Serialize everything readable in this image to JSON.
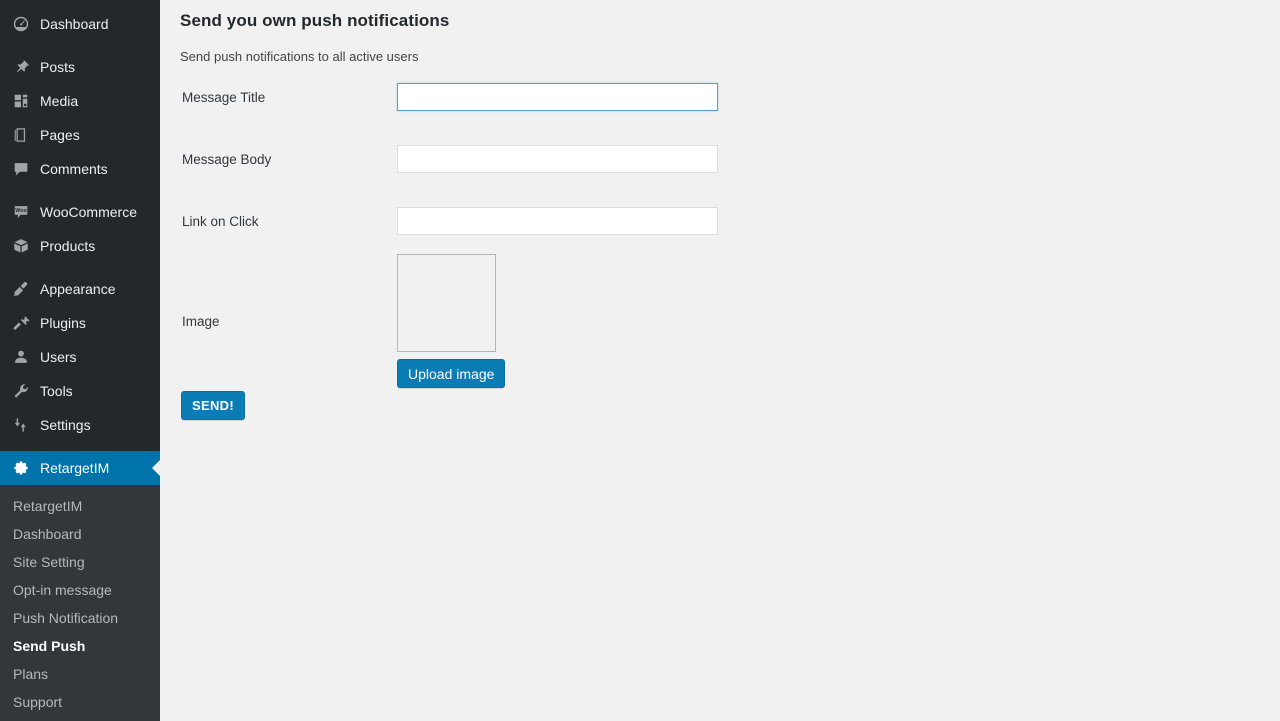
{
  "colors": {
    "sidebar_bg": "#23282d",
    "submenu_bg": "#32373c",
    "accent_blue": "#0073aa",
    "button_blue": "#0c7cb5",
    "content_bg": "#f1f1f1",
    "focus_border": "#5b9dd9"
  },
  "sidebar": {
    "groups": [
      {
        "items": [
          {
            "label": "Dashboard",
            "icon": "dashboard-icon",
            "current": false
          }
        ]
      },
      {
        "items": [
          {
            "label": "Posts",
            "icon": "pin-icon",
            "current": false
          },
          {
            "label": "Media",
            "icon": "media-icon",
            "current": false
          },
          {
            "label": "Pages",
            "icon": "pages-icon",
            "current": false
          },
          {
            "label": "Comments",
            "icon": "comments-icon",
            "current": false
          }
        ]
      },
      {
        "items": [
          {
            "label": "WooCommerce",
            "icon": "woocommerce-icon",
            "current": false
          },
          {
            "label": "Products",
            "icon": "products-box-icon",
            "current": false
          }
        ]
      },
      {
        "items": [
          {
            "label": "Appearance",
            "icon": "appearance-brush-icon",
            "current": false
          },
          {
            "label": "Plugins",
            "icon": "plugins-plug-icon",
            "current": false
          },
          {
            "label": "Users",
            "icon": "users-icon",
            "current": false
          },
          {
            "label": "Tools",
            "icon": "tools-wrench-icon",
            "current": false
          },
          {
            "label": "Settings",
            "icon": "settings-sliders-icon",
            "current": false
          }
        ]
      },
      {
        "items": [
          {
            "label": "RetargetIM",
            "icon": "gear-icon",
            "current": true
          }
        ]
      }
    ],
    "submenu": [
      {
        "label": "RetargetIM",
        "current": false
      },
      {
        "label": "Dashboard",
        "current": false
      },
      {
        "label": "Site Setting",
        "current": false
      },
      {
        "label": "Opt-in message",
        "current": false
      },
      {
        "label": "Push Notification",
        "current": false
      },
      {
        "label": "Send Push",
        "current": true
      },
      {
        "label": "Plans",
        "current": false
      },
      {
        "label": "Support",
        "current": false
      }
    ]
  },
  "main": {
    "title": "Send you own push notifications",
    "subtitle": "Send push notifications to all active users",
    "fields": [
      {
        "label": "Message Title",
        "value": "",
        "placeholder": ""
      },
      {
        "label": "Message Body",
        "value": "",
        "placeholder": ""
      },
      {
        "label": "Link on Click",
        "value": "",
        "placeholder": ""
      }
    ],
    "image_field": {
      "label": "Image",
      "upload_button_label": "Upload image"
    },
    "send_button_label": "SEND!"
  }
}
